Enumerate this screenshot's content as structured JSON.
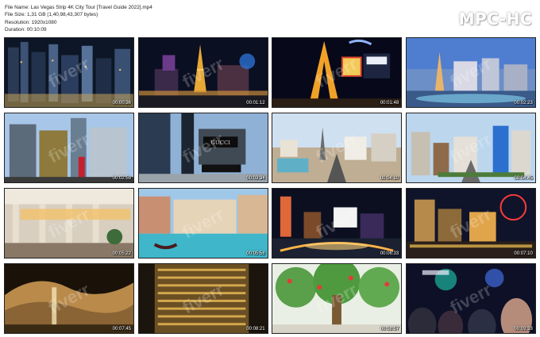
{
  "info": {
    "file_name": "File Name: Las Vegas Strip 4K City Tour [Travel Guide 2022].mp4",
    "file_size": "File Size: 1,31 GB (1,40,98,43,307 bytes)",
    "resolution": "Resolution: 1920x1080",
    "duration": "Duration: 00:10:09"
  },
  "logo": "MPC-HC",
  "watermark": "fiverr",
  "thumbnails": [
    {
      "time": "00:00:36",
      "scene": "skyline-night"
    },
    {
      "time": "00:01:12",
      "scene": "eiffel-night-wide"
    },
    {
      "time": "00:01:48",
      "scene": "eiffel-night-close"
    },
    {
      "time": "00:02:23",
      "scene": "strip-aerial-dusk"
    },
    {
      "time": "00:02:59",
      "scene": "glass-towers-day"
    },
    {
      "time": "00:03:34",
      "scene": "gucci-storefront"
    },
    {
      "time": "00:04:10",
      "scene": "strip-aerial-day"
    },
    {
      "time": "00:04:45",
      "scene": "strip-street-day"
    },
    {
      "time": "00:05:22",
      "scene": "hotel-arcade"
    },
    {
      "time": "00:05:58",
      "scene": "venetian-canal"
    },
    {
      "time": "00:06:33",
      "scene": "strip-aerial-night"
    },
    {
      "time": "00:07:10",
      "scene": "strip-ferris-wheel"
    },
    {
      "time": "00:07:45",
      "scene": "waterfall-rocks"
    },
    {
      "time": "00:08:21",
      "scene": "gold-tower"
    },
    {
      "time": "00:08:57",
      "scene": "garden-trees"
    },
    {
      "time": "00:09:33",
      "scene": "crowd-party"
    }
  ]
}
